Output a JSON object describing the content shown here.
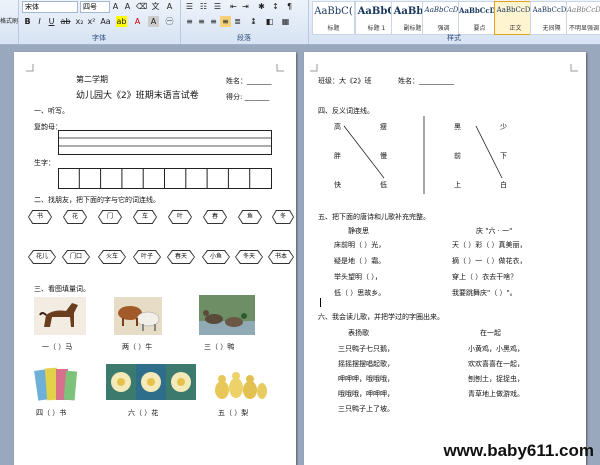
{
  "ribbon": {
    "font_name": "宋体",
    "font_size": "四号",
    "font_group_label": "字体",
    "paragraph_group_label": "段落",
    "styles_group_label": "样式",
    "clipboard_label": "格式刷",
    "styles": [
      {
        "preview": "AaBbC(",
        "name": "标题"
      },
      {
        "preview": "AaBbC",
        "name": "标题 1"
      },
      {
        "preview": "AaBbC",
        "name": "副标题"
      },
      {
        "preview": "AaBbCcDc",
        "name": "强调"
      },
      {
        "preview": "AaBbCcDc",
        "name": "要点"
      },
      {
        "preview": "AaBbCcDc",
        "name": "正文"
      },
      {
        "preview": "AaBbCcDc",
        "name": "无间隔"
      },
      {
        "preview": "AaBbCcDc",
        "name": "不明显强调"
      }
    ]
  },
  "page1": {
    "title_line1": "第二学期",
    "title_line2": "幼儿园大《2》班期末语言试卷",
    "name_label": "姓名：_______",
    "score_label": "得分:  _______",
    "s1": "一、听写。",
    "fuyun": "复韵母：",
    "shengzi": "生字：",
    "s2": "二、找朋友，把下面的字与它的词连线。",
    "chars": [
      "书",
      "花",
      "门",
      "车",
      "叶",
      "春",
      "鱼",
      "冬"
    ],
    "words": [
      "花儿",
      "门口",
      "火车",
      "叶子",
      "春天",
      "小鱼",
      "冬天",
      "书本"
    ],
    "s3": "三、看图填量词。",
    "captions_row1": [
      "一（    ）马",
      "两（    ）牛",
      "三（    ）鸭"
    ],
    "captions_row2": [
      "四（    ）书",
      "六（    ）花",
      "五（    ）梨"
    ]
  },
  "page2": {
    "class_label": "班级：大《2》班",
    "name_label": "姓名：__________",
    "s4": "四、反义词连线。",
    "ant_left_col1": [
      "高",
      "胖",
      "快"
    ],
    "ant_right_col1": [
      "瘦",
      "慢",
      "低"
    ],
    "ant_left_col2": [
      "黑",
      "前",
      "上"
    ],
    "ant_right_col2": [
      "少",
      "下",
      "白"
    ],
    "s5": "五、把下面的唐诗和儿歌补充完整。",
    "poem_title": "静夜思",
    "song_title": "庆 \"六 · 一\"",
    "poem_lines": [
      "床前明（    ）光，",
      "疑是地（    ）霜。",
      "举头望明（    ），",
      "低（    ）思故乡。"
    ],
    "song_lines": [
      "天（    ）彩（    ）真美丽，",
      "摘（    ）一（    ）做花衣，",
      "穿上（    ）衣去干啥？",
      "我要跳舞庆\"（          ）\"。"
    ],
    "s6": "六、我会读儿歌，并把学过的字圈出来。",
    "song1_title": "表扬歌",
    "song2_title": "在一起",
    "song1_lines": [
      "三只鸭子七只鹅，",
      "摇摇摆摆唱起歌，",
      "呷呷呷，哦哦哦，",
      "哦哦哦，呷呷呷，",
      "三只鸭子上了坡。"
    ],
    "song2_lines": [
      "小黄鸡，小黑鸡，",
      "欢欢喜喜在一起，",
      "刨刨土，捉捉虫，",
      "青草地上做游戏。"
    ]
  },
  "watermark": "www.baby611.com"
}
